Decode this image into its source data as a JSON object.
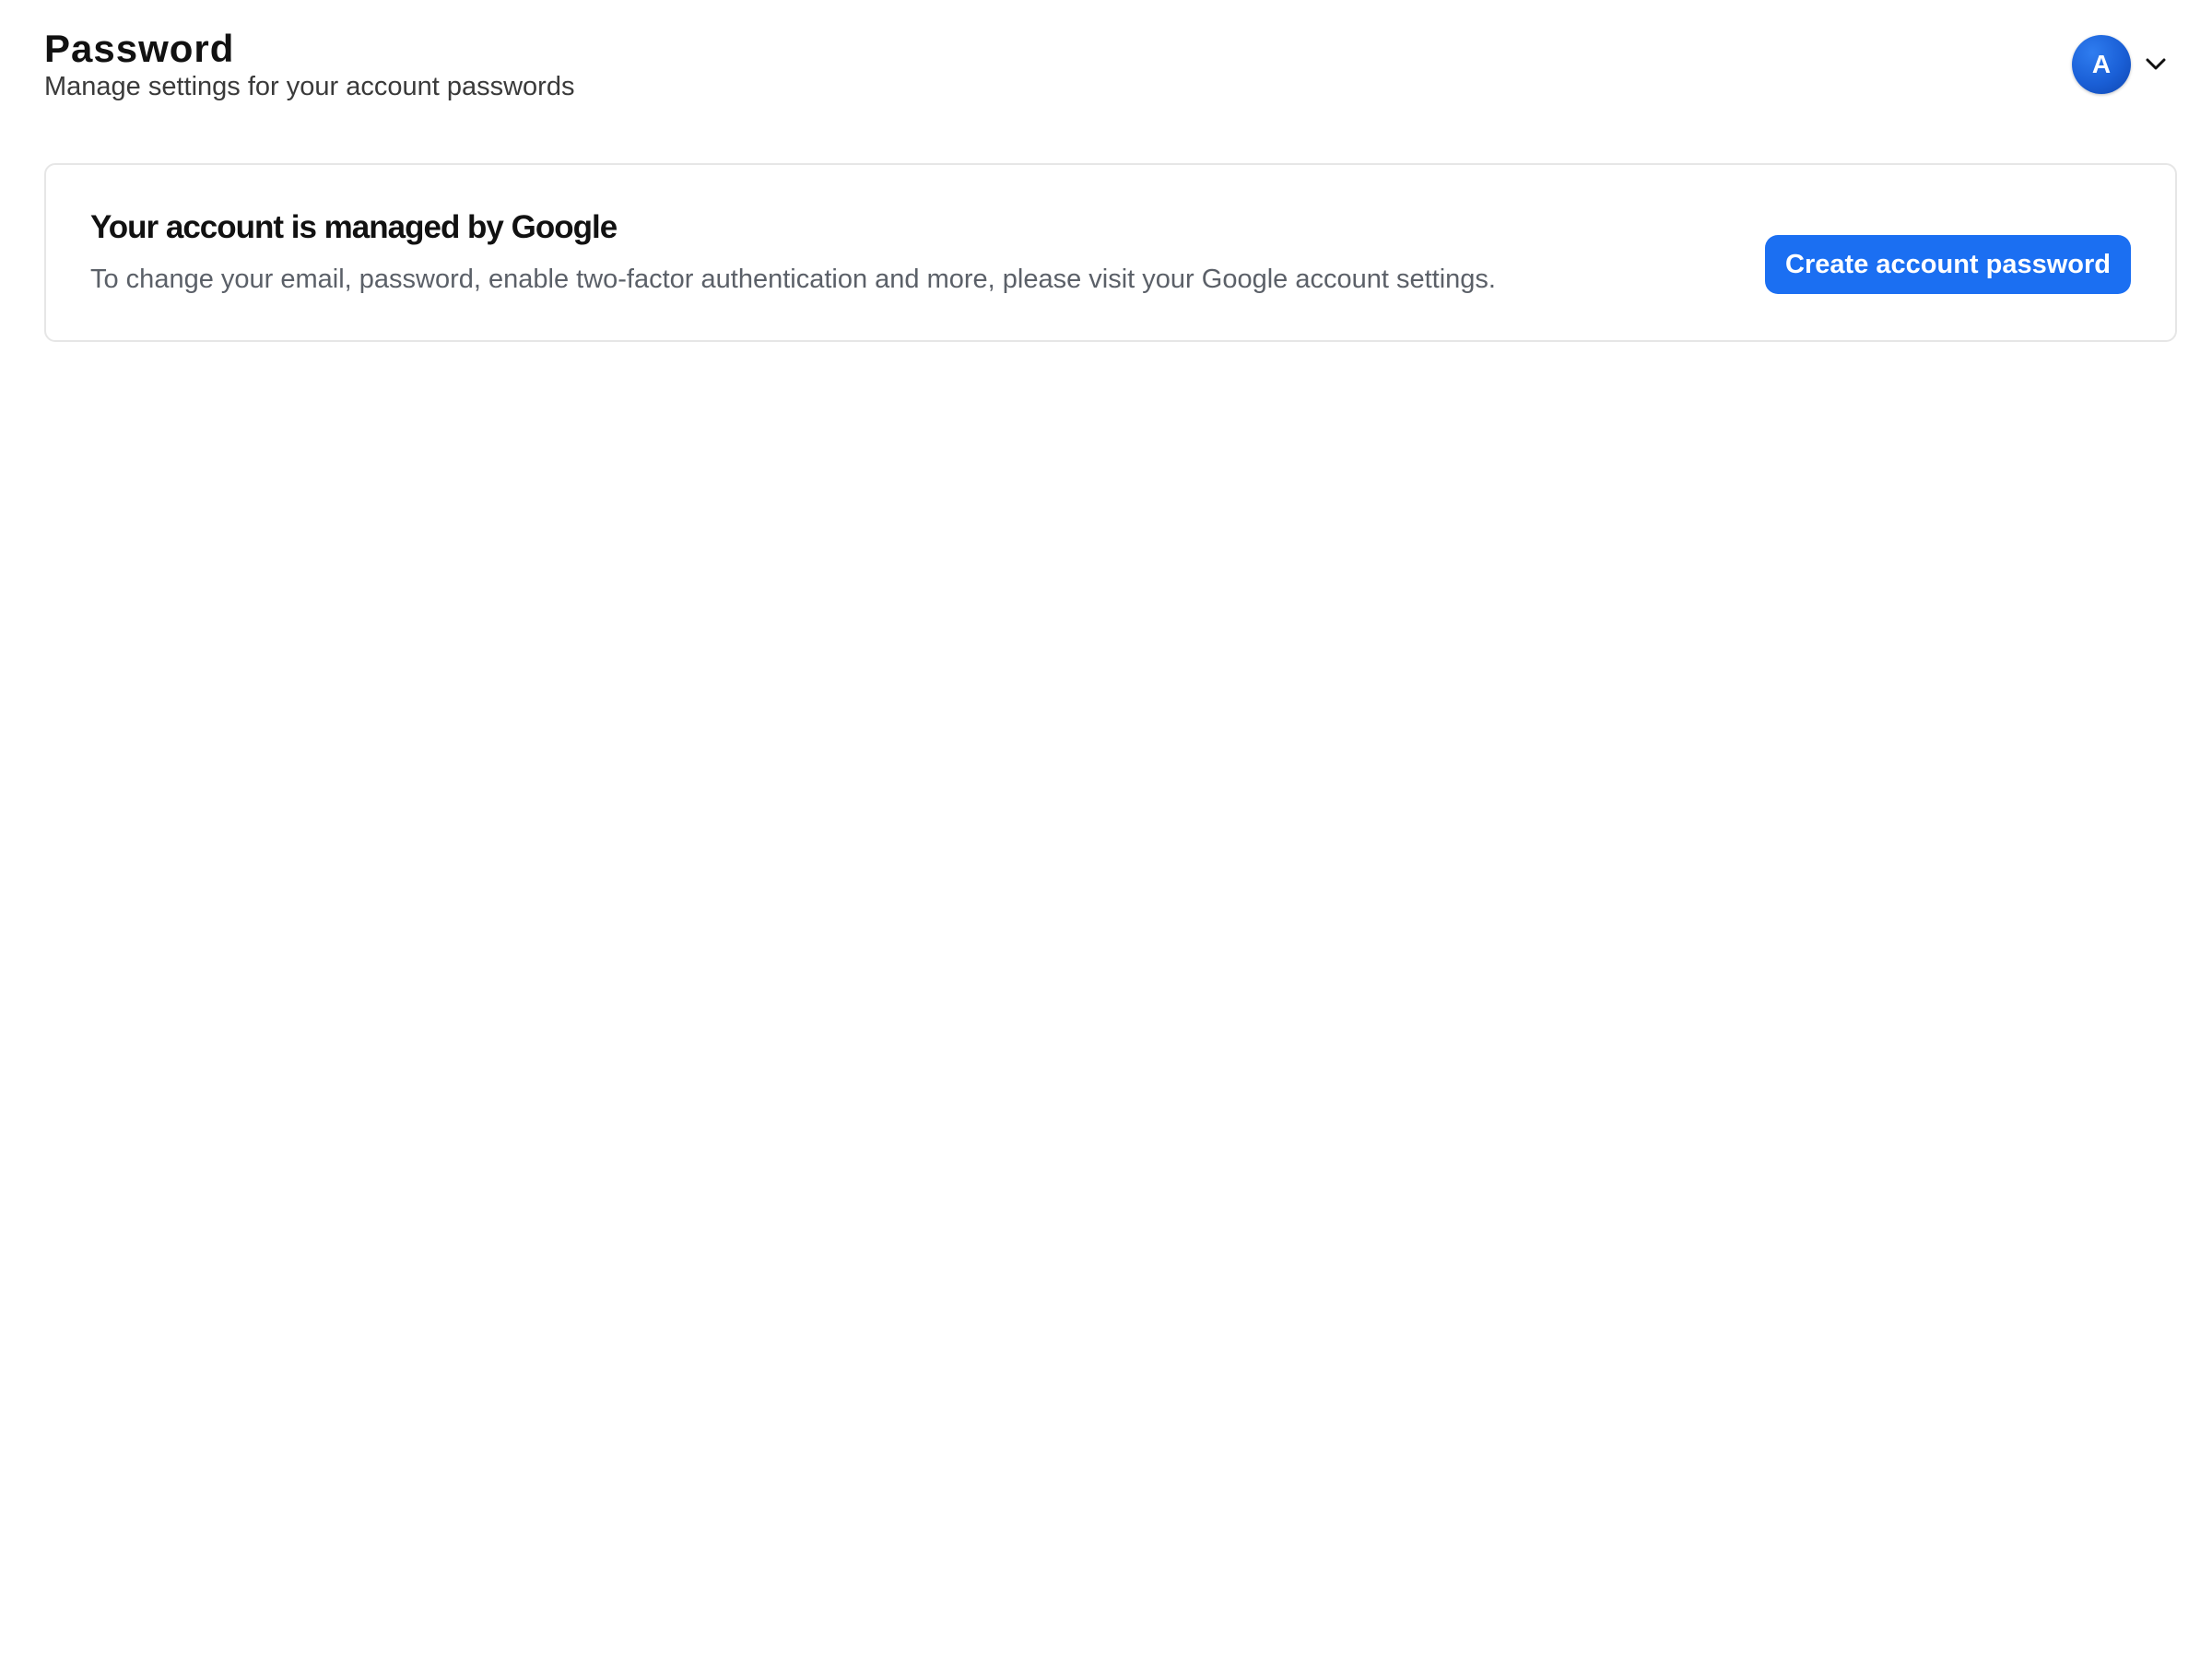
{
  "header": {
    "title": "Password",
    "subtitle": "Manage settings for your account passwords"
  },
  "account_menu": {
    "avatar_initial": "A",
    "avatar_color": "#1a5fd6",
    "dropdown_icon": "chevron-down-icon"
  },
  "managed_card": {
    "title": "Your account is managed by Google",
    "description": "To change your email, password, enable two-factor authentication and more, please visit your Google account settings.",
    "button_label": "Create account password",
    "button_color": "#1b6ff2"
  }
}
